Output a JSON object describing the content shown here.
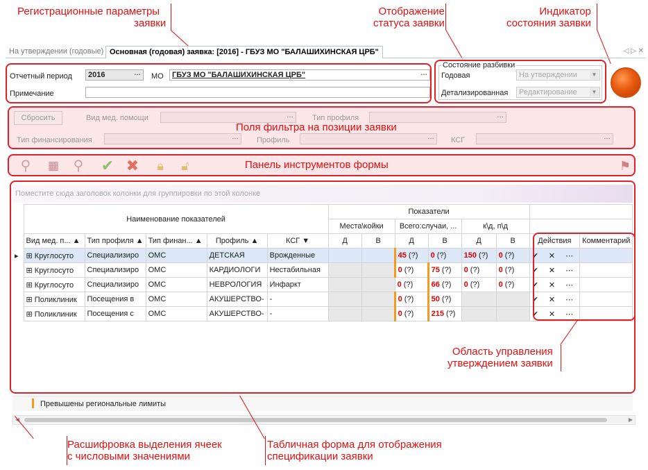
{
  "annotations": {
    "reg_params": [
      "Регистрационные параметры",
      "заявки"
    ],
    "status_display": [
      "Отображение",
      "статуса заявки"
    ],
    "state_indicator": [
      "Индикатор",
      "состояния заявки"
    ],
    "filter_fields": "Поля фильтра на позиции заявки",
    "toolbar_panel": "Панель инструментов формы",
    "approval_area": [
      "Область управления",
      "утверждением заявки"
    ],
    "legend_decode": [
      "Расшифровка выделения ячеек",
      "с числовыми значениями"
    ],
    "table_form": [
      "Табличная форма для отображения",
      "спецификации заявки"
    ]
  },
  "tabs": {
    "inactive": "На утверждении (годовые)",
    "active": "Основная (годовая) заявка: [2016] - ГБУЗ МО \"БАЛАШИХИНСКАЯ ЦРБ\""
  },
  "reg": {
    "period_label": "Отчетный период",
    "period_value": "2016",
    "mo_label": "МО",
    "mo_value": "ГБУЗ МО \"БАЛАШИХИНСКАЯ ЦРБ\"",
    "note_label": "Примечание",
    "note_value": ""
  },
  "status": {
    "group_title": "Состояние разбивки",
    "annual_label": "Годовая",
    "annual_value": "На утверждении",
    "detailed_label": "Детализированная",
    "detailed_value": "Редактирование"
  },
  "filter": {
    "reset_label": "Сбросить",
    "care_type_label": "Вид мед. помощи",
    "profile_type_label": "Тип профиля",
    "funding_type_label": "Тип финансирования",
    "profile_label": "Профиль",
    "ksg_label": "КСГ"
  },
  "grid": {
    "group_hint": "Поместите сюда заголовок колонки для группировки по этой колонке",
    "header_names": "Наименование показателей",
    "header_indicators": "Показатели",
    "sub_places": "Места\\койки",
    "sub_total": "Всего:случаи, ...",
    "sub_kd": "к\\д, п\\д",
    "col_d": "Д",
    "col_v": "В",
    "columns": [
      "Вид мед. п...",
      "Тип профиля",
      "Тип финан...",
      "Профиль",
      "КСГ"
    ],
    "actions_header": "Действия",
    "comment_header": "Комментарий",
    "actions_glyphs": "✔ ✕ ⋯",
    "rows": [
      {
        "c1": "Круглосуто",
        "c2": "Специализиро",
        "c3": "ОМС",
        "c4": "ДЕТСКАЯ",
        "c5": "Врожденные",
        "td": "45",
        "tv": "0",
        "kd": "150",
        "kv": "0"
      },
      {
        "c1": "Круглосуто",
        "c2": "Специализиро",
        "c3": "ОМС",
        "c4": "КАРДИОЛОГИ",
        "c5": "Нестабильная",
        "td": "0",
        "tv": "75",
        "kd": "0",
        "kv": "0"
      },
      {
        "c1": "Круглосуто",
        "c2": "Специализиро",
        "c3": "ОМС",
        "c4": "НЕВРОЛОГИЯ",
        "c5": "Инфаркт",
        "td": "0",
        "tv": "66",
        "kd": "0",
        "kv": "0"
      },
      {
        "c1": "Поликлиник",
        "c2": "Посещения в",
        "c3": "ОМС",
        "c4": "АКУШЕРСТВО-",
        "c5": "-",
        "td": "0",
        "tv": "50",
        "kd": "",
        "kv": ""
      },
      {
        "c1": "Поликлиник",
        "c2": "Посещения с",
        "c3": "ОМС",
        "c4": "АКУШЕРСТВО-",
        "c5": "-",
        "td": "0",
        "tv": "215",
        "kd": "",
        "kv": ""
      }
    ],
    "q_mark": "(?)"
  },
  "legend": {
    "text": "Превышены региональные лимиты",
    "color": "#f39a1f"
  },
  "colors": {
    "annotation": "#e01010",
    "accent_number": "#e00000"
  }
}
